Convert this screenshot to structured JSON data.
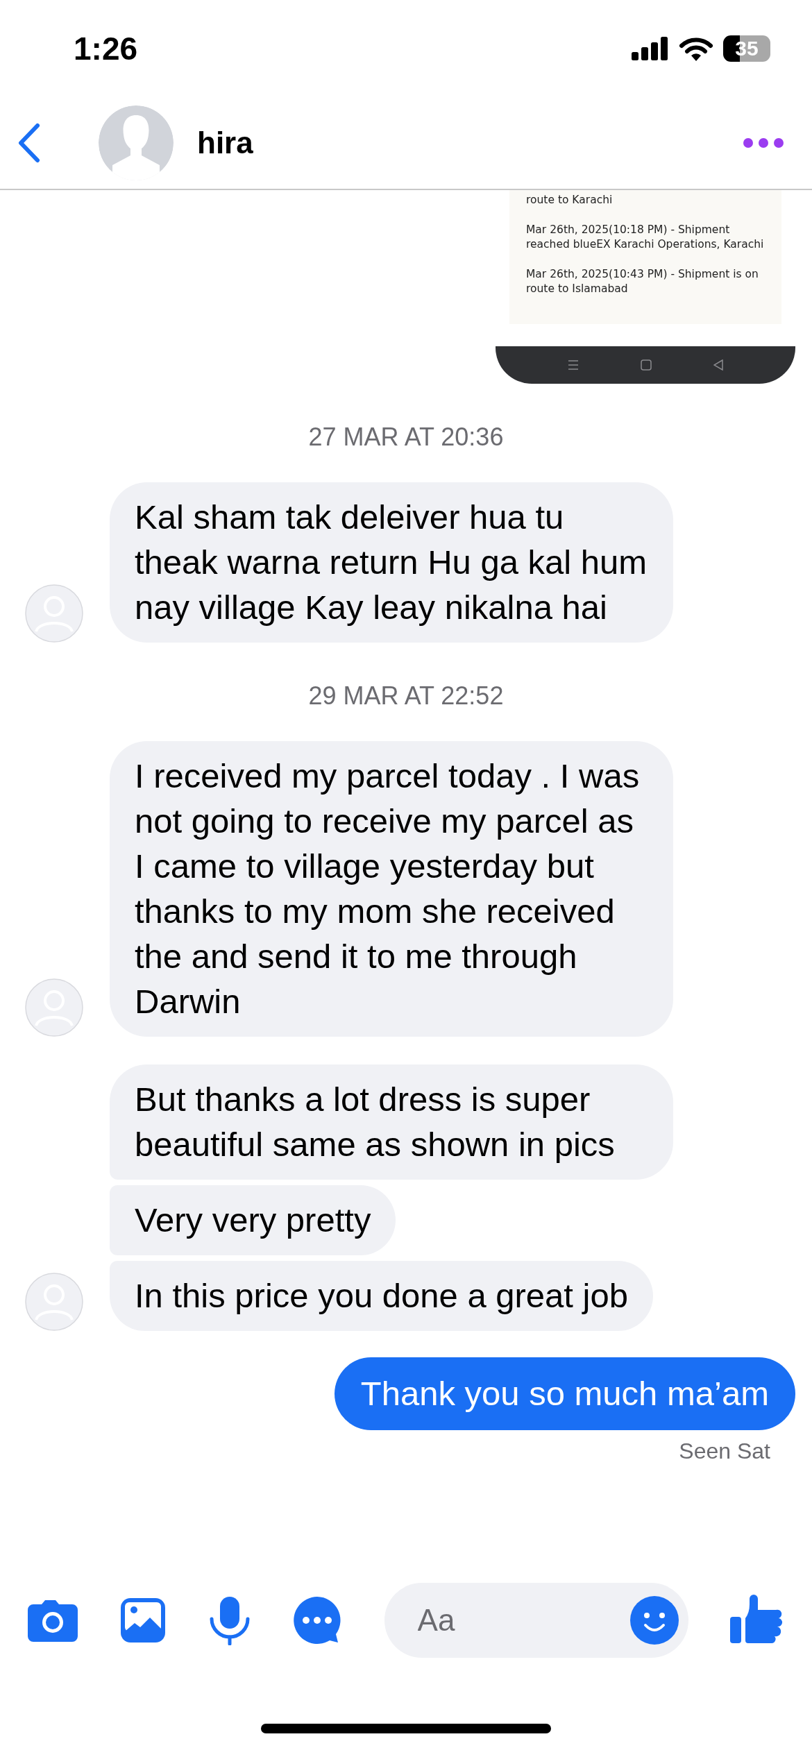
{
  "status_bar": {
    "time": "1:26",
    "battery": "35"
  },
  "header": {
    "name": "hira"
  },
  "shared_screenshot": {
    "lines": [
      "route to Karachi",
      "Mar 26th, 2025(10:18 PM) - Shipment reached blueEX Karachi Operations, Karachi",
      "Mar 26th, 2025(10:43 PM) - Shipment is on route to Islamabad"
    ]
  },
  "messages": [
    {
      "kind": "timestamp",
      "text": "27 MAR AT 20:36"
    },
    {
      "kind": "received",
      "text": "Kal sham tak deleiver hua tu theak warna return Hu ga kal hum nay village Kay leay nikalna hai",
      "avatar": true
    },
    {
      "kind": "timestamp",
      "text": "29 MAR AT 22:52"
    },
    {
      "kind": "received",
      "text": "I received my parcel today . I was not going to receive my parcel as I came to village yesterday but thanks to my mom she received the  and send it to me through Darwin",
      "avatar": true
    },
    {
      "kind": "received",
      "text": "But thanks a lot dress is super beautiful same as shown in pics",
      "avatar": false
    },
    {
      "kind": "received",
      "text": "Very very pretty",
      "avatar": false
    },
    {
      "kind": "received",
      "text": "In this price you done a great job",
      "avatar": true
    },
    {
      "kind": "sent",
      "text": "Thank you so much ma’am"
    }
  ],
  "seen": "Seen Sat",
  "composer": {
    "placeholder": "Aa"
  }
}
